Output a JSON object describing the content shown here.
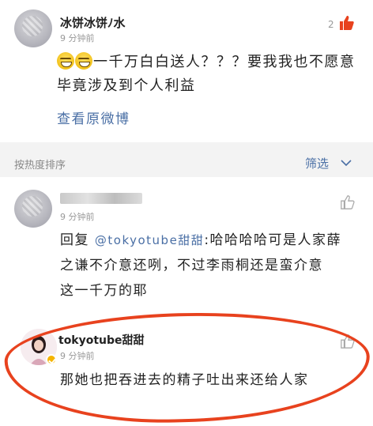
{
  "post_comment": {
    "author": "冰饼冰饼ﾉ水",
    "time": "9 分钟前",
    "like_count": "2",
    "text": "一千万白白送人？？？要我我也不愿意毕竟涉及到个人利益",
    "view_original_label": "查看原微博"
  },
  "sort_bar": {
    "sort_label": "按热度排序",
    "filter_label": "筛选"
  },
  "reply1": {
    "time": "9 分钟前",
    "reply_prefix": "回复 ",
    "mention": "@tokyotube甜甜",
    "text_part1": ":哈哈哈哈可是人家薛",
    "text_part2": "之谦不介意还咧，不过李雨桐还是蛮介意",
    "text_part3": "这一千万的耶"
  },
  "reply2": {
    "author": "tokyotube甜甜",
    "time": "9 分钟前",
    "text": "那她也把吞进去的精子吐出来还给人家"
  },
  "colors": {
    "accent_red": "#e8421e",
    "link_blue": "#4a6fa5",
    "like_active": "#e8421e"
  }
}
